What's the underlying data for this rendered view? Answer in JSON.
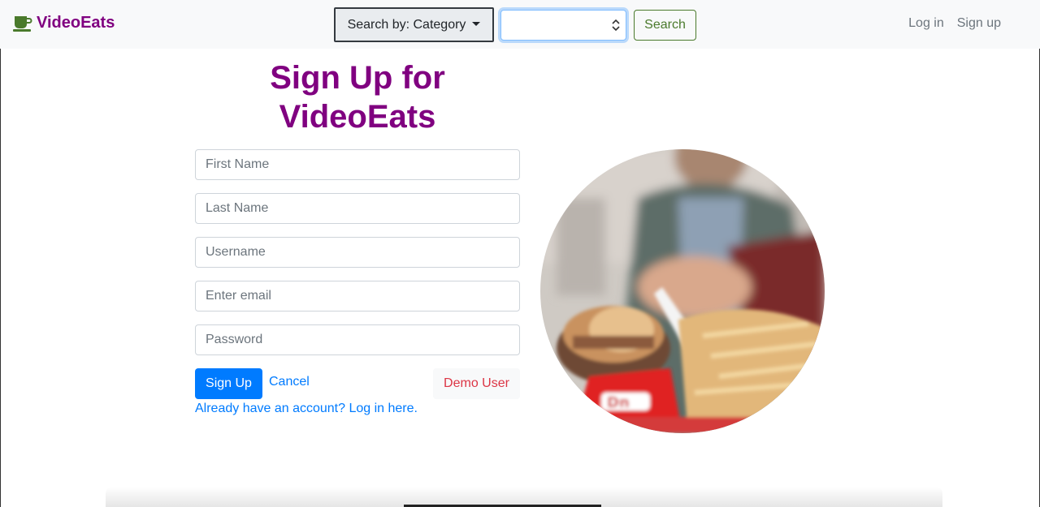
{
  "navbar": {
    "brand": "VideoEats",
    "brand_icon": "coffee-cup-icon",
    "category_button": "Search by: Category",
    "category_select_value": "",
    "search_button": "Search",
    "login_link": "Log in",
    "signup_link": "Sign up"
  },
  "form": {
    "title_line1": "Sign Up for",
    "title_line2": "VideoEats",
    "first_name_placeholder": "First Name",
    "last_name_placeholder": "Last Name",
    "username_placeholder": "Username",
    "email_placeholder": "Enter email",
    "password_placeholder": "Password",
    "signup_button": "Sign Up",
    "cancel_link": "Cancel",
    "demo_button": "Demo User",
    "login_prompt": "Already have an account? Log in here."
  },
  "colors": {
    "brand": "#800080",
    "primary": "#007bff",
    "success_outline": "#4a7a2c",
    "danger": "#dc3545",
    "navbar_bg": "#f8f9fa"
  }
}
